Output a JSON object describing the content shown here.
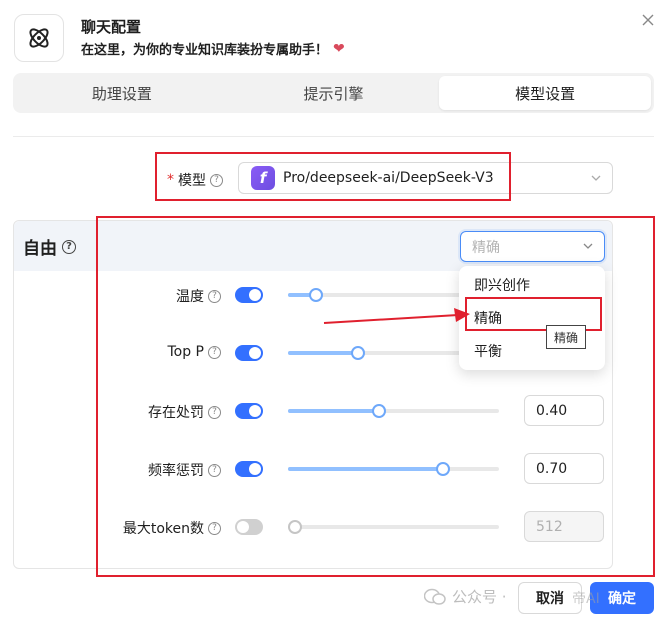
{
  "dialog": {
    "title": "聊天配置",
    "subtitle": "在这里，为你的专业知识库装扮专属助手！",
    "close_icon": "close-icon",
    "brand_icon": "atom-icon"
  },
  "tabs": [
    {
      "label": "助理设置",
      "active": false
    },
    {
      "label": "提示引擎",
      "active": false
    },
    {
      "label": "模型设置",
      "active": true
    }
  ],
  "model": {
    "required_mark": "*",
    "label": "模型",
    "value": "Pro/deepseek-ai/DeepSeek-V3",
    "logo_letter": "f"
  },
  "params": {
    "section_title": "自由",
    "preset_placeholder": "精确",
    "rows": [
      {
        "label": "温度",
        "enabled": true,
        "slider_fraction": 0.1,
        "value": ""
      },
      {
        "label": "Top P",
        "enabled": true,
        "slider_fraction": 0.3,
        "value": ""
      },
      {
        "label": "存在处罚",
        "enabled": true,
        "slider_fraction": 0.4,
        "value": "0.40"
      },
      {
        "label": "频率惩罚",
        "enabled": true,
        "slider_fraction": 0.7,
        "value": "0.70"
      },
      {
        "label": "最大token数",
        "enabled": false,
        "slider_fraction": 0.0,
        "value": "512"
      }
    ]
  },
  "dropdown": {
    "options": [
      "即兴创作",
      "精确",
      "平衡"
    ],
    "tooltip": "精确"
  },
  "footer": {
    "watermark": "公众号 ·",
    "cancel_label": "取消",
    "ok_label": "确定",
    "watermark_right": "帝AI"
  },
  "colors": {
    "accent": "#3370ff",
    "annotation": "#e0202e"
  }
}
